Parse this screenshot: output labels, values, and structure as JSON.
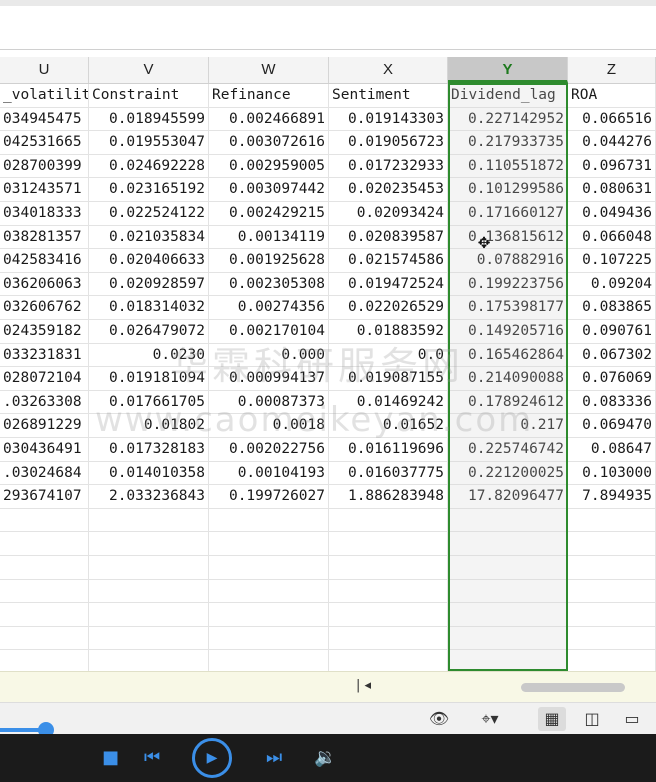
{
  "columns": [
    {
      "letter": "U",
      "header": "_volatilit"
    },
    {
      "letter": "V",
      "header": "Constraint"
    },
    {
      "letter": "W",
      "header": "Refinance"
    },
    {
      "letter": "X",
      "header": "Sentiment"
    },
    {
      "letter": "Y",
      "header": "Dividend_lag"
    },
    {
      "letter": "Z",
      "header": "ROA"
    }
  ],
  "selected_column": "Y",
  "rows": [
    [
      "034945475",
      "0.018945599",
      "0.002466891",
      "0.019143303",
      "0.227142952",
      "0.066516"
    ],
    [
      "042531665",
      "0.019553047",
      "0.003072616",
      "0.019056723",
      "0.217933735",
      "0.044276"
    ],
    [
      "028700399",
      "0.024692228",
      "0.002959005",
      "0.017232933",
      "0.110551872",
      "0.096731"
    ],
    [
      "031243571",
      "0.023165192",
      "0.003097442",
      "0.020235453",
      "0.101299586",
      "0.080631"
    ],
    [
      "034018333",
      "0.022524122",
      "0.002429215",
      "0.02093424",
      "0.171660127",
      "0.049436"
    ],
    [
      "038281357",
      "0.021035834",
      "0.00134119",
      "0.020839587",
      "0.136815612",
      "0.066048"
    ],
    [
      "042583416",
      "0.020406633",
      "0.001925628",
      "0.021574586",
      "0.07882916",
      "0.107225"
    ],
    [
      "036206063",
      "0.020928597",
      "0.002305308",
      "0.019472524",
      "0.199223756",
      "0.09204"
    ],
    [
      "032606762",
      "0.018314032",
      "0.00274356",
      "0.022026529",
      "0.175398177",
      "0.083865"
    ],
    [
      "024359182",
      "0.026479072",
      "0.002170104",
      "0.01883592",
      "0.149205716",
      "0.090761"
    ],
    [
      "033231831",
      "0.0230",
      "0.000",
      "0.0",
      "0.165462864",
      "0.067302"
    ],
    [
      "028072104",
      "0.019181094",
      "0.000994137",
      "0.019087155",
      "0.214090088",
      "0.076069"
    ],
    [
      ".03263308",
      "0.017661705",
      "0.00087373",
      "0.01469242",
      "0.178924612",
      "0.083336"
    ],
    [
      "026891229",
      "0.01802",
      "0.0018",
      "0.01652",
      "0.217",
      "0.069470"
    ],
    [
      "030436491",
      "0.017328183",
      "0.002022756",
      "0.016119696",
      "0.225746742",
      "0.08647"
    ],
    [
      ".03024684",
      "0.014010358",
      "0.00104193",
      "0.016037775",
      "0.221200025",
      "0.103000"
    ],
    [
      "293674107",
      "2.033236843",
      "0.199726027",
      "1.886283948",
      "17.82096477",
      "7.894935"
    ]
  ],
  "watermark_line1": "华霖科研服务网",
  "watermark_line2": "www.caomeikeyan.com",
  "scroll_nav": "| ◂",
  "status_icons": [
    "eye-icon",
    "crosshair-icon",
    "normal-view-icon",
    "page-layout-icon",
    "page-break-icon"
  ],
  "player_icons": [
    "stop-icon",
    "previous-icon",
    "play-icon",
    "next-icon",
    "volume-icon"
  ],
  "accent_color": "#2e8b2e",
  "player_accent": "#3b8fe8"
}
